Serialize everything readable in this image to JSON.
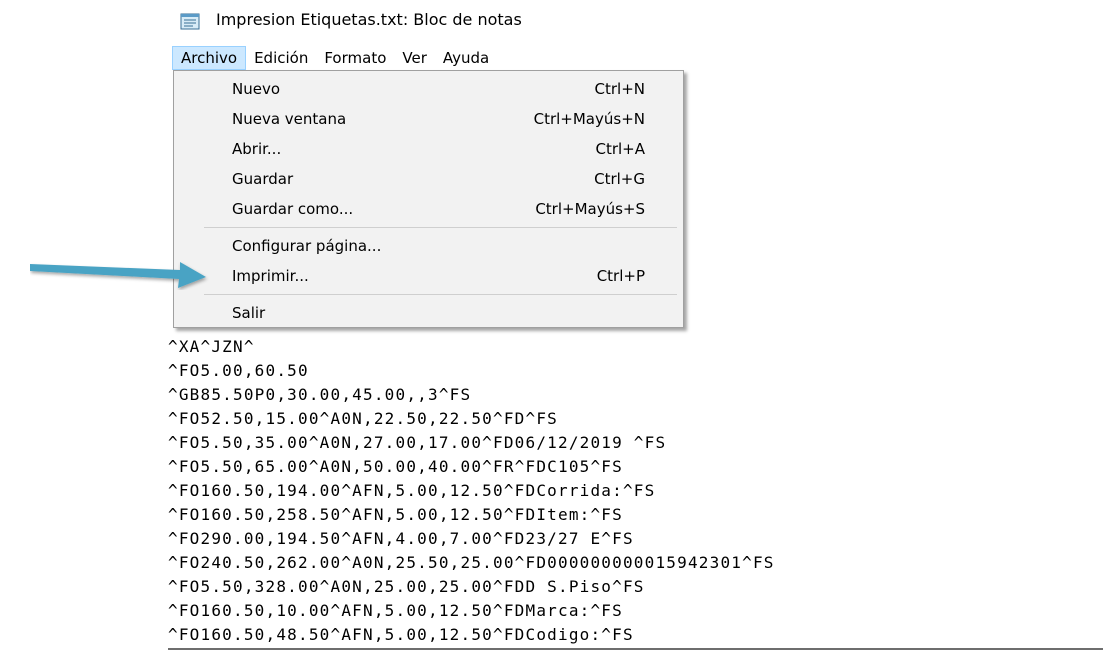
{
  "window": {
    "title": "Impresion Etiquetas.txt: Bloc de notas",
    "icon": "notepad-icon"
  },
  "menubar": {
    "items": [
      {
        "label": "Archivo",
        "active": true
      },
      {
        "label": "Edición"
      },
      {
        "label": "Formato"
      },
      {
        "label": "Ver"
      },
      {
        "label": "Ayuda"
      }
    ]
  },
  "file_menu": {
    "items": [
      {
        "label": "Nuevo",
        "shortcut": "Ctrl+N"
      },
      {
        "label": "Nueva ventana",
        "shortcut": "Ctrl+Mayús+N"
      },
      {
        "label": "Abrir...",
        "shortcut": "Ctrl+A"
      },
      {
        "label": "Guardar",
        "shortcut": "Ctrl+G"
      },
      {
        "label": "Guardar como...",
        "shortcut": "Ctrl+Mayús+S"
      },
      {
        "label": "Configurar página...",
        "shortcut": ""
      },
      {
        "label": "Imprimir...",
        "shortcut": "Ctrl+P"
      },
      {
        "label": "Salir",
        "shortcut": ""
      }
    ]
  },
  "editor": {
    "lines": [
      "^XA^JZN^",
      "^FO5.00,60.50",
      "^GB85.50P0,30.00,45.00,,3^FS",
      "^FO52.50,15.00^A0N,22.50,22.50^FD^FS",
      "^FO5.50,35.00^A0N,27.00,17.00^FD06/12/2019 ^FS",
      "^FO5.50,65.00^A0N,50.00,40.00^FR^FDC105^FS",
      "^FO160.50,194.00^AFN,5.00,12.50^FDCorrida:^FS",
      "^FO160.50,258.50^AFN,5.00,12.50^FDItem:^FS",
      "^FO290.00,194.50^AFN,4.00,7.00^FD23/27 E^FS",
      "^FO240.50,262.00^A0N,25.50,25.00^FD000000000015942301^FS",
      "^FO5.50,328.00^A0N,25.00,25.00^FDD S.Piso^FS",
      "^FO160.50,10.00^AFN,5.00,12.50^FDMarca:^FS",
      "^FO160.50,48.50^AFN,5.00,12.50^FDCodigo:^FS"
    ]
  },
  "annotation": {
    "arrow_color": "#4aa3c4"
  }
}
